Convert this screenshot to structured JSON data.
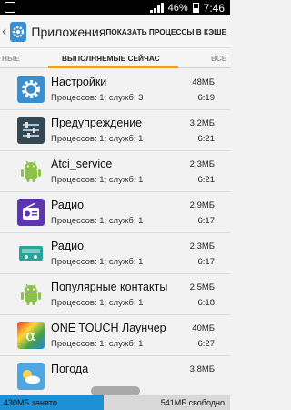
{
  "status_bar": {
    "battery": "46%",
    "time": "7:46"
  },
  "action_bar": {
    "back": "‹",
    "title": "Приложения",
    "action": "ПОКАЗАТЬ ПРОЦЕССЫ В КЭШЕ"
  },
  "tabs": {
    "left": "НЫЕ",
    "active": "ВЫПОЛНЯЕМЫЕ СЕЙЧАС",
    "right": "ВСЕ"
  },
  "apps": [
    {
      "name": "Настройки",
      "detail": "Процессов: 1; служб: 3",
      "size": "48МБ",
      "time": "6:19",
      "icon": "settings-icon"
    },
    {
      "name": "Предупреждение",
      "detail": "Процессов: 1; служб: 1",
      "size": "3,2МБ",
      "time": "6:21",
      "icon": "sliders-icon"
    },
    {
      "name": "Atci_service",
      "detail": "Процессов: 1; служб: 1",
      "size": "2,3МБ",
      "time": "6:21",
      "icon": "android-icon"
    },
    {
      "name": "Радио",
      "detail": "Процессов: 1; служб: 1",
      "size": "2,9МБ",
      "time": "6:17",
      "icon": "radio-icon"
    },
    {
      "name": "Радио",
      "detail": "Процессов: 1; служб: 1",
      "size": "2,3МБ",
      "time": "6:17",
      "icon": "fm-radio-icon"
    },
    {
      "name": "Популярные контакты",
      "detail": "Процессов: 1; служб: 1",
      "size": "2,5МБ",
      "time": "6:18",
      "icon": "android-icon"
    },
    {
      "name": "ONE TOUCH Лаунчер",
      "detail": "Процессов: 1; служб: 1",
      "size": "40МБ",
      "time": "6:27",
      "icon": "launcher-icon"
    },
    {
      "name": "Погода",
      "detail": "",
      "size": "3,8МБ",
      "time": "",
      "icon": "weather-icon"
    }
  ],
  "storage": {
    "used": "430МБ занято",
    "free": "541МБ свободно"
  }
}
